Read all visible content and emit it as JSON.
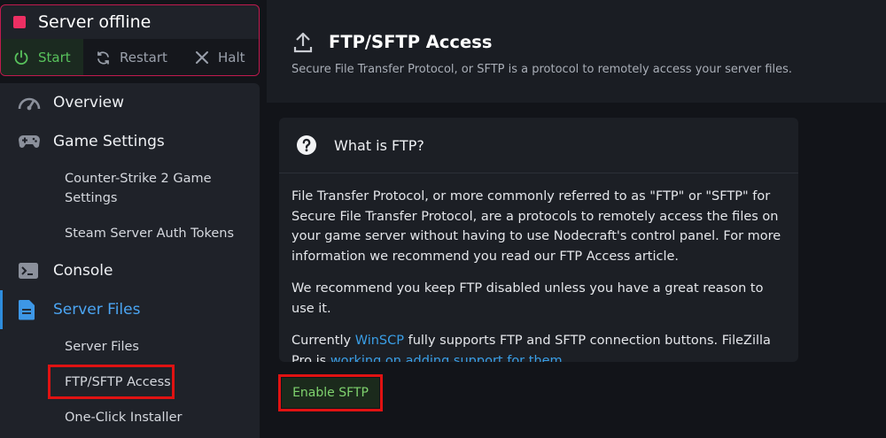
{
  "server": {
    "status_text": "Server offline",
    "status_color": "#ec2f63",
    "buttons": {
      "start": "Start",
      "restart": "Restart",
      "halt": "Halt"
    }
  },
  "sidebar": {
    "overview": "Overview",
    "game_settings": "Game Settings",
    "game_settings_sub": [
      "Counter-Strike 2 Game",
      "Settings"
    ],
    "steam_tokens": "Steam Server Auth Tokens",
    "console": "Console",
    "server_files": "Server Files",
    "server_files_sub": "Server Files",
    "ftp_access": "FTP/SFTP Access",
    "installer": "One-Click Installer",
    "active_color": "#4ba5f3"
  },
  "header": {
    "title": "FTP/SFTP Access",
    "subtitle": "Secure File Transfer Protocol, or SFTP is a protocol to remotely access your server files."
  },
  "faq": {
    "title": "What is FTP?",
    "para1": "File Transfer Protocol, or more commonly referred to as \"FTP\" or \"SFTP\" for Secure File Transfer Protocol, are a protocols to remotely access the files on your game server without having to use Nodecraft's control panel. For more information we recommend you read our FTP Access article.",
    "para2": "We recommend you keep FTP disabled unless you have a great reason to use it.",
    "para3_prefix": "Currently ",
    "para3_link1": "WinSCP",
    "para3_middle": " fully supports FTP and SFTP connection buttons. FileZilla Pro is ",
    "para3_link2": "working on adding support for them",
    "para3_suffix": "."
  },
  "actions": {
    "enable_sftp": "Enable SFTP"
  },
  "highlight_color": "#e01212"
}
